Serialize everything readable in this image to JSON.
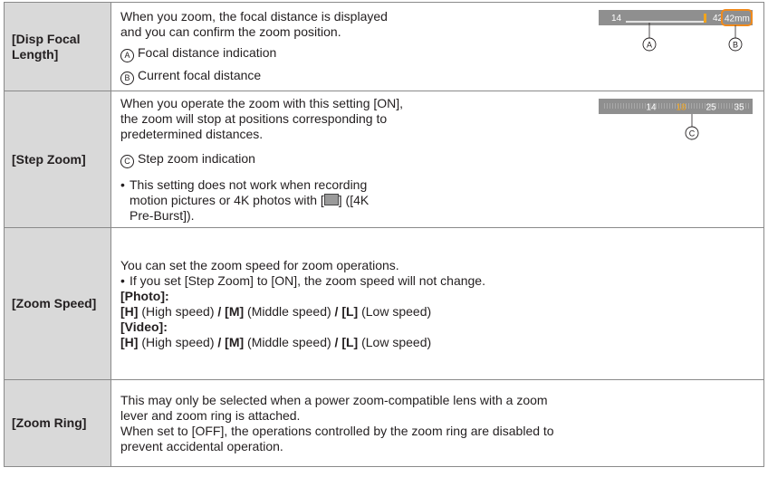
{
  "rows": [
    {
      "term": "[Disp Focal Length]",
      "lines": [
        "When you zoom, the focal distance is displayed",
        "and you can confirm the zoom position."
      ],
      "callouts": [
        {
          "marker": "A",
          "text": "Focal distance indication"
        },
        {
          "marker": "B",
          "text": "Current focal distance"
        }
      ],
      "figure": {
        "min": "14",
        "max": "42",
        "current": "42mm",
        "marker_a": "A",
        "marker_b": "B"
      }
    },
    {
      "term": "[Step Zoom]",
      "lines": [
        "When you operate the zoom with this setting [ON],",
        "the zoom will stop at positions corresponding to",
        "predetermined distances."
      ],
      "callout": {
        "marker": "C",
        "text": "Step zoom indication"
      },
      "note_lines": [
        "This setting does not work when recording",
        "motion pictures or 4K photos with [",
        "] ([4K",
        "Pre-Burst])."
      ],
      "figure": {
        "ticks": [
          "14",
          "18",
          "25",
          "35"
        ],
        "marker_c": "C"
      }
    },
    {
      "term": "[Zoom Speed]",
      "intro": "You can set the zoom speed for zoom operations.",
      "note": "If you set [Step Zoom] to [ON], the zoom speed will not change.",
      "photo_label": "[Photo]:",
      "video_label": "[Video]:",
      "speeds": {
        "h": "[H]",
        "h_desc": "(High speed)",
        "m": "[M]",
        "m_desc": "(Middle speed)",
        "l": "[L]",
        "l_desc": "(Low speed)",
        "sep": "/"
      }
    },
    {
      "term": "[Zoom Ring]",
      "lines": [
        "This may only be selected when a power zoom-compatible lens with a zoom",
        "lever and zoom ring is attached.",
        "When set to [OFF], the operations controlled by the zoom ring are disabled to",
        "prevent accidental operation."
      ]
    }
  ]
}
